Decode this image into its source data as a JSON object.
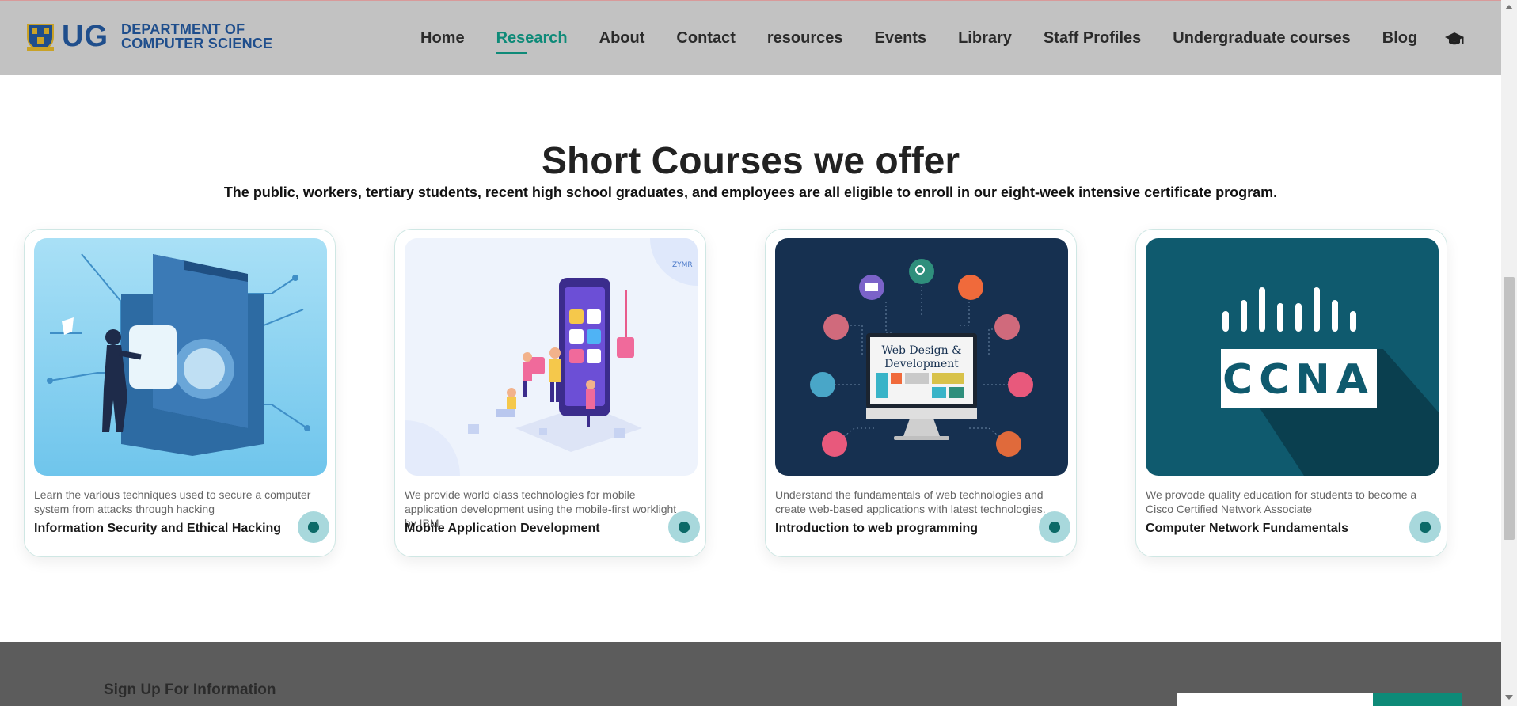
{
  "header": {
    "logo_text": "UG",
    "dept_line1": "DEPARTMENT OF",
    "dept_line2": "COMPUTER SCIENCE",
    "nav": [
      "Home",
      "Research",
      "About",
      "Contact",
      "resources",
      "Events",
      "Library",
      "Staff Profiles",
      "Undergraduate courses",
      "Blog"
    ],
    "active_nav": "Research",
    "cap_icon": "graduation-cap-icon"
  },
  "section": {
    "title": "Short Courses we offer",
    "subtitle": "The public, workers, tertiary students, recent high school graduates, and employees are all eligible to enroll in our eight-week intensive certificate program."
  },
  "courses": [
    {
      "title": "Information Security and Ethical Hacking",
      "description": "Learn the various techniques used to secure a computer system from attacks through hacking",
      "image": "security-illustration"
    },
    {
      "title": "Mobile Application Development",
      "description": "We provide world class technologies for mobile application development using the mobile-first worklight by IBM",
      "image": "mobile-app-illustration",
      "image_badge": "ZYMR"
    },
    {
      "title": "Introduction to web programming",
      "description": "Understand the fundamentals of web technologies and create web-based applications with latest technologies.",
      "image": "web-design-illustration",
      "image_text_line1": "Web Design &",
      "image_text_line2": "Development"
    },
    {
      "title": "Computer Network Fundamentals",
      "description": "We provode quality education for students to become a Cisco Certified Network Associate",
      "image": "ccna-illustration",
      "image_text": "CCNA"
    }
  ],
  "footer": {
    "signup_heading": "Sign Up For Information"
  },
  "colors": {
    "accent": "#0e8a78",
    "header_bg": "#c2c2c2",
    "brand_blue": "#1f4e8c",
    "footer_bg": "#5c5c5c"
  }
}
